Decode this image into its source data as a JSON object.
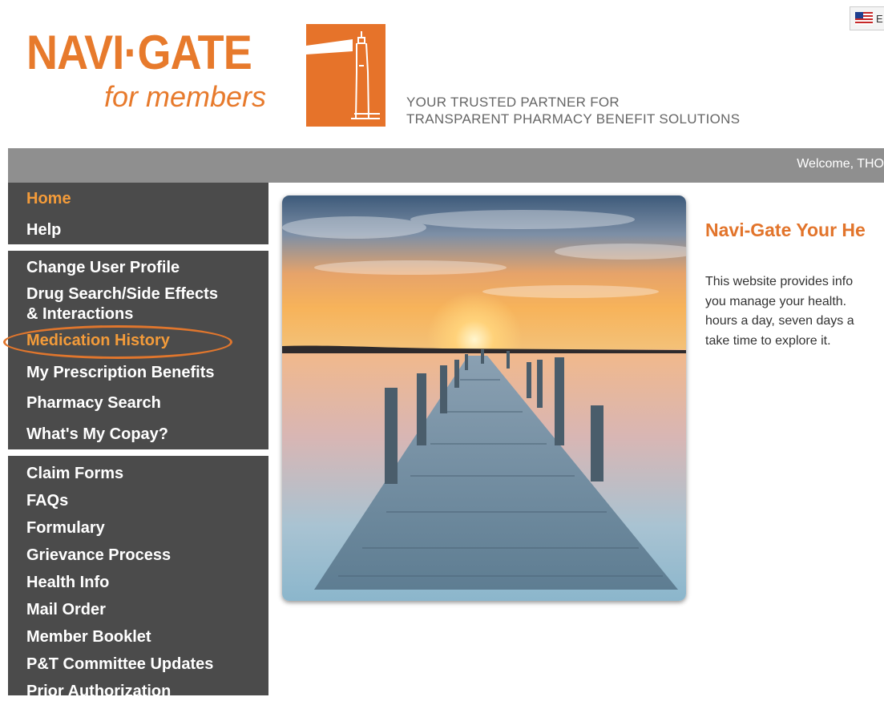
{
  "header": {
    "logo_primary": "NAVI·GATE",
    "logo_secondary": "for members",
    "tagline_line1": "YOUR TRUSTED PARTNER FOR",
    "tagline_line2": "TRANSPARENT PHARMACY BENEFIT SOLUTIONS",
    "language_flag": "us-flag-icon",
    "language_label": "E"
  },
  "topbar": {
    "welcome_text": "Welcome,  THO"
  },
  "sidebar": {
    "group1": [
      {
        "label": "Home",
        "active": true
      },
      {
        "label": "Help",
        "active": false
      }
    ],
    "group2": [
      {
        "label": "Change User Profile"
      },
      {
        "label": "Drug Search/Side Effects"
      },
      {
        "label": "& Interactions"
      },
      {
        "label": "Medication History",
        "highlighted": true
      },
      {
        "label": "My Prescription Benefits"
      },
      {
        "label": "Pharmacy Search"
      },
      {
        "label": "What's My Copay?"
      }
    ],
    "group3": [
      {
        "label": "Claim Forms"
      },
      {
        "label": "FAQs"
      },
      {
        "label": "Formulary"
      },
      {
        "label": "Grievance Process"
      },
      {
        "label": "Health Info"
      },
      {
        "label": "Mail Order"
      },
      {
        "label": "Member Booklet"
      },
      {
        "label": "P&T Committee Updates"
      },
      {
        "label": "Prior Authorization"
      }
    ]
  },
  "main": {
    "title": "Navi-Gate Your He",
    "intro_lines": [
      "This website provides info",
      "you manage your health.",
      "hours a day, seven days a",
      "take time to explore it."
    ]
  },
  "colors": {
    "brand_orange": "#e77a2c",
    "sidebar_bg": "#4b4b4b",
    "topbar_bg": "#8f8f8f",
    "active_link": "#f39b3a"
  }
}
